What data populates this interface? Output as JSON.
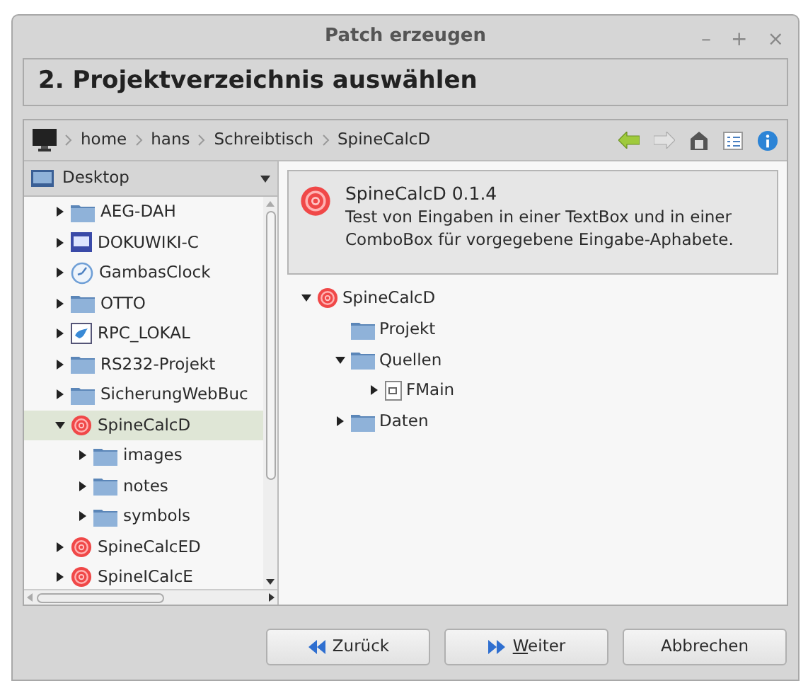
{
  "window": {
    "title": "Patch erzeugen",
    "controls": [
      "–",
      "+",
      "×"
    ]
  },
  "step_heading": "2. Projektverzeichnis auswählen",
  "path_bar": {
    "crumbs": [
      "home",
      "hans",
      "Schreibtisch",
      "SpineCalcD"
    ]
  },
  "location": {
    "label": "Desktop"
  },
  "folder_tree": [
    {
      "label": "AEG-DAH",
      "kind": "folder",
      "expanded": false,
      "selected": false
    },
    {
      "label": "DOKUWIKI-C",
      "kind": "app",
      "expanded": false,
      "selected": false
    },
    {
      "label": "GambasClock",
      "kind": "clock",
      "expanded": false,
      "selected": false
    },
    {
      "label": "OTTO",
      "kind": "folder",
      "expanded": false,
      "selected": false
    },
    {
      "label": "RPC_LOKAL",
      "kind": "bird",
      "expanded": false,
      "selected": false
    },
    {
      "label": "RS232-Projekt",
      "kind": "folder",
      "expanded": false,
      "selected": false
    },
    {
      "label": "SicherungWebBuc",
      "kind": "folder",
      "expanded": false,
      "selected": false
    },
    {
      "label": "SpineCalcD",
      "kind": "target",
      "expanded": true,
      "selected": true,
      "children": [
        {
          "label": "images",
          "kind": "folder",
          "expanded": false,
          "selected": false
        },
        {
          "label": "notes",
          "kind": "folder",
          "expanded": false,
          "selected": false
        },
        {
          "label": "symbols",
          "kind": "folder",
          "expanded": false,
          "selected": false
        }
      ]
    },
    {
      "label": "SpineCalcED",
      "kind": "target",
      "expanded": false,
      "selected": false
    },
    {
      "label": "SpineICalcE",
      "kind": "target",
      "expanded": false,
      "selected": false
    }
  ],
  "project_info": {
    "name": "SpineCalcD",
    "version": "0.1.4",
    "description": "Test von Eingaben in einer TextBox und in einer ComboBox für vorgegebene Eingabe-Aphabete."
  },
  "project_tree": [
    {
      "label": "SpineCalcD",
      "kind": "target",
      "expanded": true,
      "children": [
        {
          "label": "Projekt",
          "kind": "folder",
          "expanded": false
        },
        {
          "label": "Quellen",
          "kind": "folder",
          "expanded": true,
          "children": [
            {
              "label": "FMain",
              "kind": "form",
              "expanded": false
            }
          ]
        },
        {
          "label": "Daten",
          "kind": "folder",
          "expanded": false
        }
      ]
    }
  ],
  "buttons": [
    {
      "label": "Zurück",
      "kind": "back",
      "mnemonic": false
    },
    {
      "label": "Weiter",
      "kind": "next",
      "mnemonic": true
    },
    {
      "label": "Abbrechen",
      "kind": "cancel",
      "mnemonic": false
    }
  ]
}
